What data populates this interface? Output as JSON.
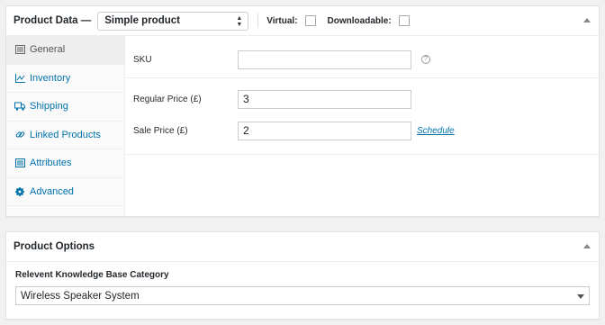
{
  "product_data": {
    "title": "Product Data —",
    "product_type": "Simple product",
    "virtual_label": "Virtual:",
    "downloadable_label": "Downloadable:",
    "tabs": [
      {
        "label": "General",
        "icon": "general-icon"
      },
      {
        "label": "Inventory",
        "icon": "chart-line-icon"
      },
      {
        "label": "Shipping",
        "icon": "truck-icon"
      },
      {
        "label": "Linked Products",
        "icon": "link-icon"
      },
      {
        "label": "Attributes",
        "icon": "list-icon"
      },
      {
        "label": "Advanced",
        "icon": "gear-icon"
      }
    ],
    "fields": {
      "sku": {
        "label": "SKU",
        "value": ""
      },
      "regular_price": {
        "label": "Regular Price (£)",
        "value": "3"
      },
      "sale_price": {
        "label": "Sale Price (£)",
        "value": "2"
      }
    },
    "schedule_link": "Schedule",
    "help_glyph": "?"
  },
  "product_options": {
    "title": "Product Options",
    "kb_label": "Relevent Knowledge Base Category",
    "kb_selected": "Wireless Speaker System"
  },
  "colors": {
    "link": "#0073aa",
    "active_tab_bg": "#eeeeee"
  }
}
